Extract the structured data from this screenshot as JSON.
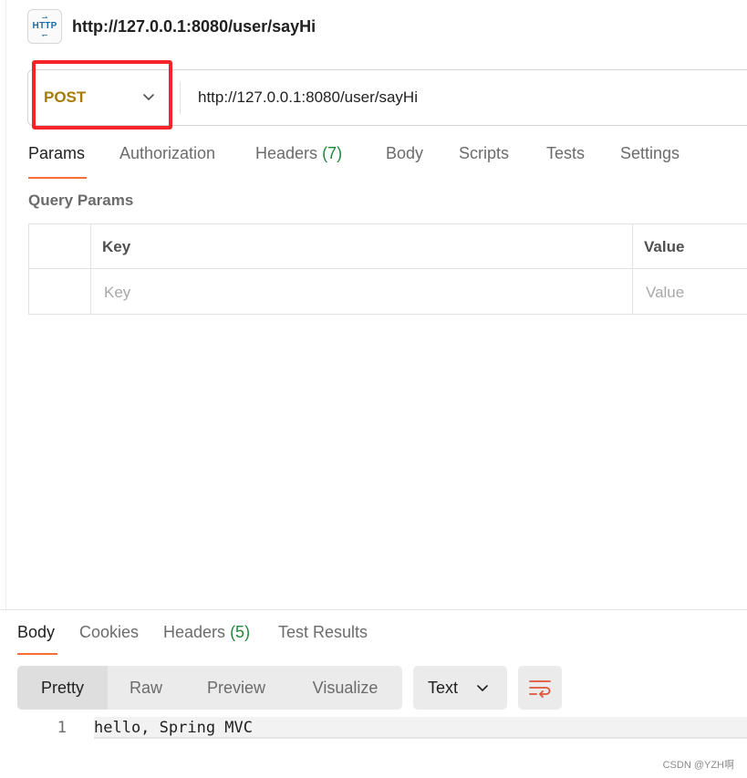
{
  "request": {
    "title": "http://127.0.0.1:8080/user/sayHi",
    "icon_text": "HTTP",
    "method": "POST",
    "url": "http://127.0.0.1:8080/user/sayHi"
  },
  "request_tabs": [
    {
      "label": "Params"
    },
    {
      "label": "Authorization"
    },
    {
      "label": "Headers",
      "count": "(7)"
    },
    {
      "label": "Body"
    },
    {
      "label": "Scripts"
    },
    {
      "label": "Tests"
    },
    {
      "label": "Settings"
    }
  ],
  "query_params": {
    "title": "Query Params",
    "columns": [
      "Key",
      "Value"
    ],
    "placeholders": {
      "key": "Key",
      "value": "Value"
    }
  },
  "response_tabs": [
    {
      "label": "Body"
    },
    {
      "label": "Cookies"
    },
    {
      "label": "Headers",
      "count": "(5)"
    },
    {
      "label": "Test Results"
    }
  ],
  "response_format": {
    "options": [
      "Pretty",
      "Raw",
      "Preview",
      "Visualize"
    ],
    "selected": "Pretty",
    "language": "Text"
  },
  "response_body": {
    "lines": [
      {
        "number": "1",
        "text": "hello, Spring MVC"
      }
    ]
  },
  "watermark": "CSDN @YZH啊",
  "colors": {
    "method_post": "#a77b08",
    "accent": "#ff6c37",
    "count_green": "#1f8a3b",
    "highlight_red": "#f5242a"
  }
}
